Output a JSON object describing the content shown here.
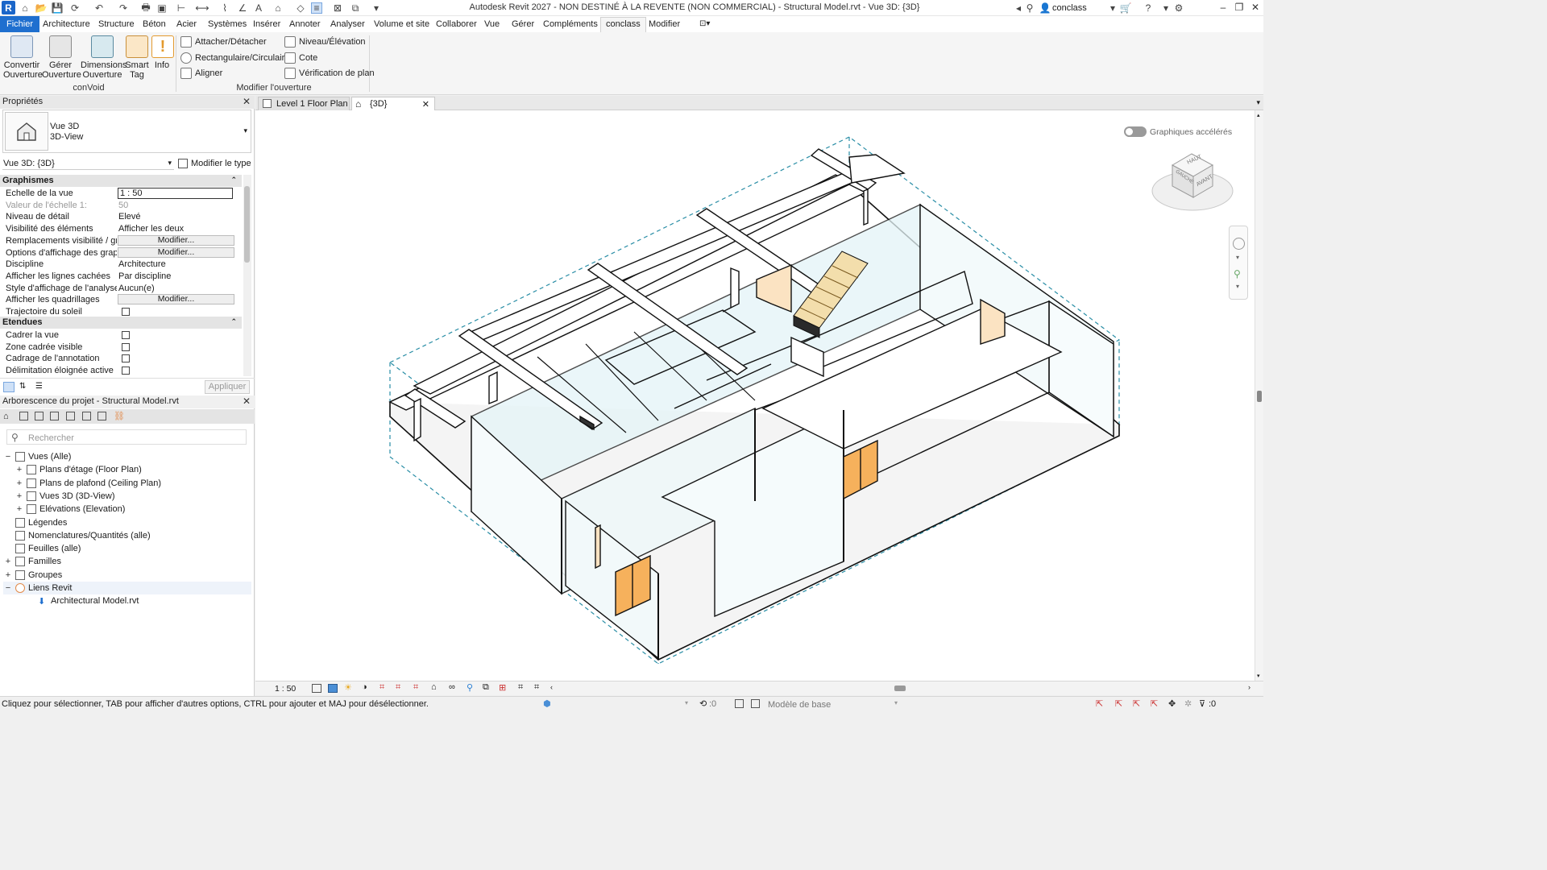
{
  "titlebar": {
    "title": "Autodesk Revit 2027 - NON DESTINÉ À LA REVENTE (NON COMMERCIAL) - Structural Model.rvt - Vue 3D: {3D}",
    "user": "conclass",
    "app_logo": "R"
  },
  "menu": {
    "tabs": [
      "Fichier",
      "Architecture",
      "Structure",
      "Béton",
      "Acier",
      "Systèmes",
      "Insérer",
      "Annoter",
      "Analyser",
      "Volume et site",
      "Collaborer",
      "Vue",
      "Gérer",
      "Compléments",
      "conclass",
      "Modifier"
    ]
  },
  "ribbon": {
    "convoid": {
      "buttons": [
        {
          "line1": "Convertir",
          "line2": "Ouverture"
        },
        {
          "line1": "Gérer",
          "line2": "Ouverture"
        },
        {
          "line1": "Dimensions",
          "line2": "Ouverture"
        },
        {
          "line1": "Smart",
          "line2": "Tag"
        },
        {
          "line1": "Info",
          "line2": ""
        }
      ],
      "label": "conVoid"
    },
    "modifier": {
      "col1": [
        "Attacher/Détacher",
        "Rectangulaire/Circulaire",
        "Aligner"
      ],
      "col2": [
        "Niveau/Élévation",
        "Cote",
        "Vérification de plan"
      ],
      "label": "Modifier l'ouverture"
    }
  },
  "properties": {
    "title": "Propriétés",
    "type_name": "Vue 3D",
    "type_sub": "3D-View",
    "selector": "Vue 3D: {3D}",
    "edit_type": "Modifier le type",
    "sections": {
      "graphics": "Graphismes",
      "extents": "Etendues"
    },
    "rows_graphics": [
      {
        "name": "Echelle de la vue",
        "value": "1 : 50",
        "kind": "input"
      },
      {
        "name": "Valeur de l'échelle    1:",
        "value": "50",
        "kind": "grey"
      },
      {
        "name": "Niveau de détail",
        "value": "Elevé",
        "kind": "text"
      },
      {
        "name": "Visibilité des éléments",
        "value": "Afficher les deux",
        "kind": "text"
      },
      {
        "name": "Remplacements visibilité / gr...",
        "value": "Modifier...",
        "kind": "button"
      },
      {
        "name": "Options d'affichage des grap...",
        "value": "Modifier...",
        "kind": "button"
      },
      {
        "name": "Discipline",
        "value": "Architecture",
        "kind": "text"
      },
      {
        "name": "Afficher les lignes cachées",
        "value": "Par discipline",
        "kind": "text"
      },
      {
        "name": "Style d'affichage de l'analyse ...",
        "value": "Aucun(e)",
        "kind": "text"
      },
      {
        "name": "Afficher les quadrillages",
        "value": "Modifier...",
        "kind": "button"
      },
      {
        "name": "Trajectoire du soleil",
        "value": "",
        "kind": "checkbox"
      }
    ],
    "rows_extents": [
      {
        "name": "Cadrer la vue",
        "value": "",
        "kind": "checkbox"
      },
      {
        "name": "Zone cadrée visible",
        "value": "",
        "kind": "checkbox"
      },
      {
        "name": "Cadrage de l'annotation",
        "value": "",
        "kind": "checkbox"
      },
      {
        "name": "Délimitation éloignée active",
        "value": "",
        "kind": "checkbox"
      }
    ],
    "apply": "Appliquer"
  },
  "browser": {
    "title": "Arborescence du projet - Structural Model.rvt",
    "search_placeholder": "Rechercher",
    "items": [
      {
        "label": "Vues (Alle)",
        "level": 0,
        "exp": "−"
      },
      {
        "label": "Plans d'étage (Floor Plan)",
        "level": 1,
        "exp": "+"
      },
      {
        "label": "Plans de plafond (Ceiling Plan)",
        "level": 1,
        "exp": "+"
      },
      {
        "label": "Vues 3D (3D-View)",
        "level": 1,
        "exp": "+"
      },
      {
        "label": "Elévations (Elevation)",
        "level": 1,
        "exp": "+"
      },
      {
        "label": "Légendes",
        "level": 0,
        "exp": ""
      },
      {
        "label": "Nomenclatures/Quantités (alle)",
        "level": 0,
        "exp": ""
      },
      {
        "label": "Feuilles (alle)",
        "level": 0,
        "exp": ""
      },
      {
        "label": "Familles",
        "level": 0,
        "exp": "+"
      },
      {
        "label": "Groupes",
        "level": 0,
        "exp": "+"
      },
      {
        "label": "Liens Revit",
        "level": 0,
        "exp": "−"
      },
      {
        "label": "Architectural Model.rvt",
        "level": 2,
        "exp": ""
      }
    ]
  },
  "views": {
    "tabs": [
      "Level 1 Floor Plan",
      "{3D}"
    ],
    "accel_label": "Graphiques accélérés",
    "viewcube": {
      "top": "HAUT",
      "front": "AVANT",
      "left": "GAUCHE"
    }
  },
  "viewbar": {
    "scale": "1 : 50"
  },
  "status": {
    "message": "Cliquez pour sélectionner, TAB pour afficher d'autres options,  CTRL pour ajouter et MAJ pour désélectionner.",
    "workset_count": ":0",
    "model": "Modèle de base",
    "filter_count": ":0"
  },
  "colors": {
    "accent": "#1f6fcf",
    "door": "#f6b15c",
    "wall_glass": "#dff2f5",
    "crop": "#2a8ea6"
  }
}
